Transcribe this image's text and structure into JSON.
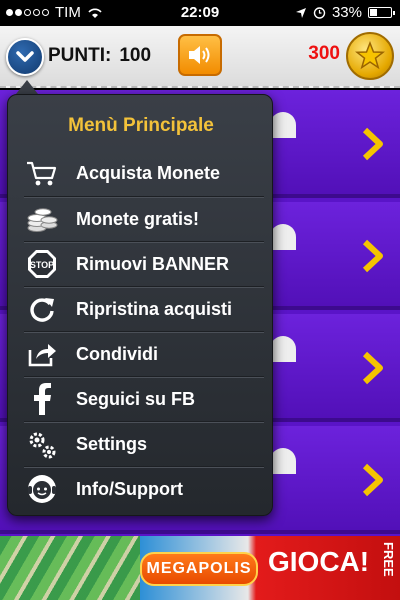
{
  "status_bar": {
    "carrier": "TIM",
    "time": "22:09",
    "battery": "33%",
    "signal_bars_filled": 2,
    "signal_bars_total": 5,
    "battery_fraction": 0.33
  },
  "header": {
    "points_label": "PUNTI:",
    "points_value": "100",
    "coins_value": "300",
    "menu_icon": "chevron-down-icon",
    "sound_icon": "speaker-icon",
    "coin_icon": "star-coin-icon"
  },
  "menu": {
    "title": "Menù Principale",
    "items": [
      {
        "label": "Acquista Monete",
        "icon": "cart-icon"
      },
      {
        "label": "Monete gratis!",
        "icon": "coins-stack-icon"
      },
      {
        "label": "Rimuovi BANNER",
        "icon": "stop-sign-icon"
      },
      {
        "label": "Ripristina acquisti",
        "icon": "refresh-icon"
      },
      {
        "label": "Condividi",
        "icon": "share-icon"
      },
      {
        "label": "Seguici su FB",
        "icon": "facebook-icon"
      },
      {
        "label": "Settings",
        "icon": "gears-icon"
      },
      {
        "label": "Info/Support",
        "icon": "support-headset-icon"
      }
    ]
  },
  "banner": {
    "logo_text": "MEGAPOLIS",
    "cta": "GIOCA!",
    "tag": "FREE"
  },
  "colors": {
    "accent_title": "#f3c23a",
    "content_bg": "#5a14c8",
    "chevron": "#f5c400",
    "coins_red": "#e11111"
  }
}
